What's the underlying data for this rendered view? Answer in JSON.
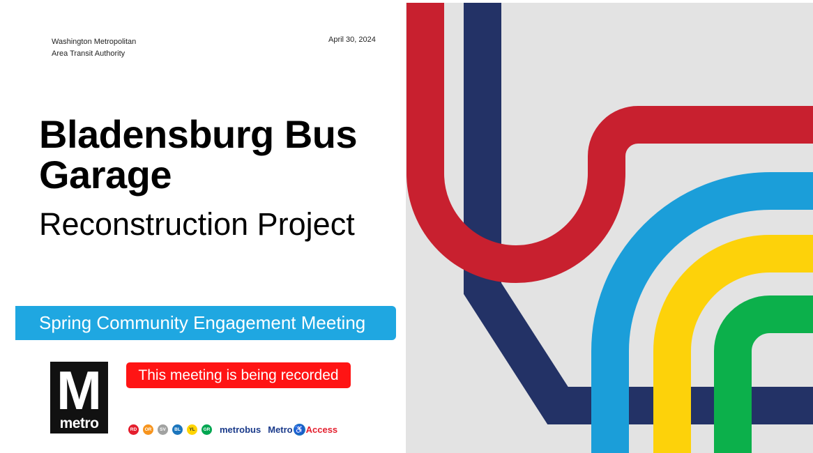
{
  "header": {
    "org_line1": "Washington Metropolitan",
    "org_line2": "Area Transit Authority",
    "date": "April 30, 2024"
  },
  "title": {
    "line1": "Bladensburg Bus",
    "line2": "Garage",
    "subtitle": "Reconstruction Project"
  },
  "banner": {
    "text": "Spring Community Engagement Meeting",
    "color": "#1fa7e1"
  },
  "logo": {
    "letter": "M",
    "word": "metro"
  },
  "recording_notice": {
    "text": "This meeting is being recorded",
    "color": "#ff1414"
  },
  "footer": {
    "lines": [
      {
        "code": "RD",
        "color": "#e41e2d"
      },
      {
        "code": "OR",
        "color": "#f7941d"
      },
      {
        "code": "SV",
        "color": "#a1a2a1"
      },
      {
        "code": "BL",
        "color": "#1b75bc"
      },
      {
        "code": "YL",
        "color": "#ffd400"
      },
      {
        "code": "GR",
        "color": "#00a651"
      }
    ],
    "metrobus": "metrobus",
    "metroaccess_part1": "Metro",
    "metroaccess_icon": "wheelchair-icon",
    "metroaccess_part2": "Access"
  },
  "art_colors": {
    "background": "#e3e3e3",
    "red": "#c8202f",
    "navy": "#233266",
    "blue": "#1b9ed9",
    "yellow": "#fdd20a",
    "green": "#0cb04b"
  }
}
